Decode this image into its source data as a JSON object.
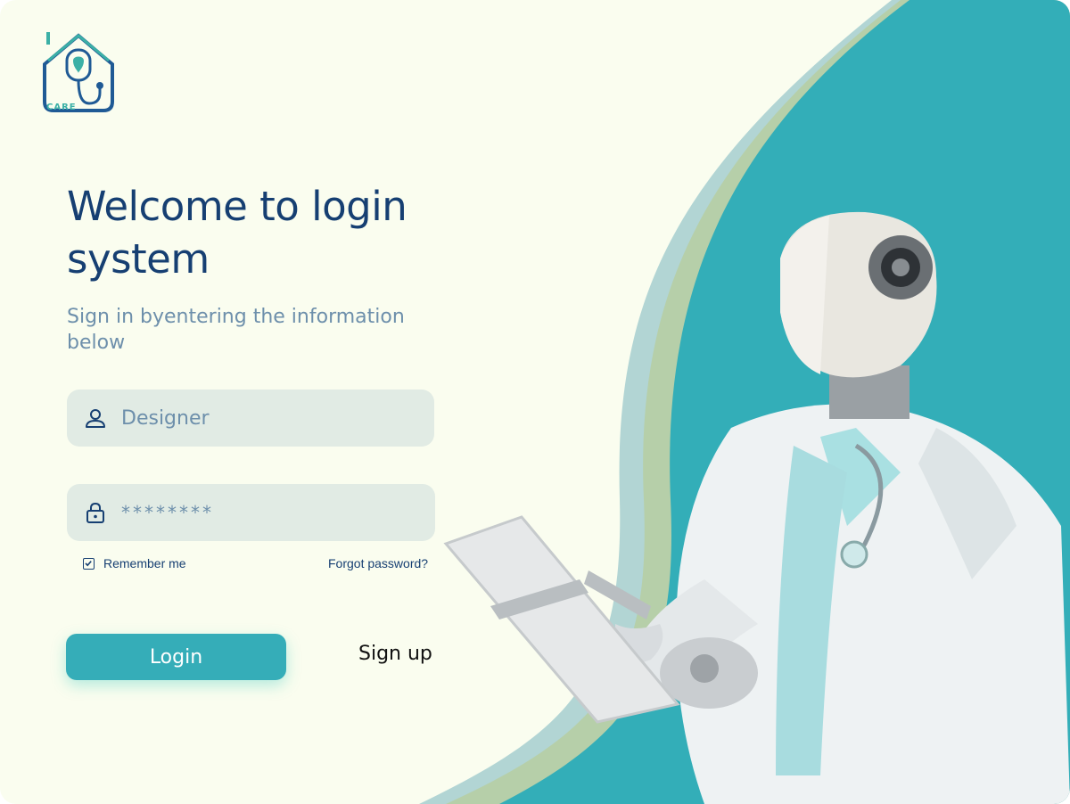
{
  "brand": {
    "logo_text": "CARE",
    "colors": {
      "primary": "#163f72",
      "accent": "#35adb8",
      "background": "#fafdef"
    }
  },
  "heading": {
    "title": "Welcome to login system",
    "subtitle": "Sign in byentering the information below"
  },
  "form": {
    "username": {
      "value": "Designer",
      "icon": "user-icon"
    },
    "password": {
      "value": "********",
      "icon": "lock-icon"
    },
    "remember_label": "Remember me",
    "remember_checked": true,
    "forgot_label": "Forgot password?"
  },
  "actions": {
    "login_label": "Login",
    "signup_label": "Sign up"
  },
  "illustration": {
    "subject": "robot-doctor-illustration"
  }
}
